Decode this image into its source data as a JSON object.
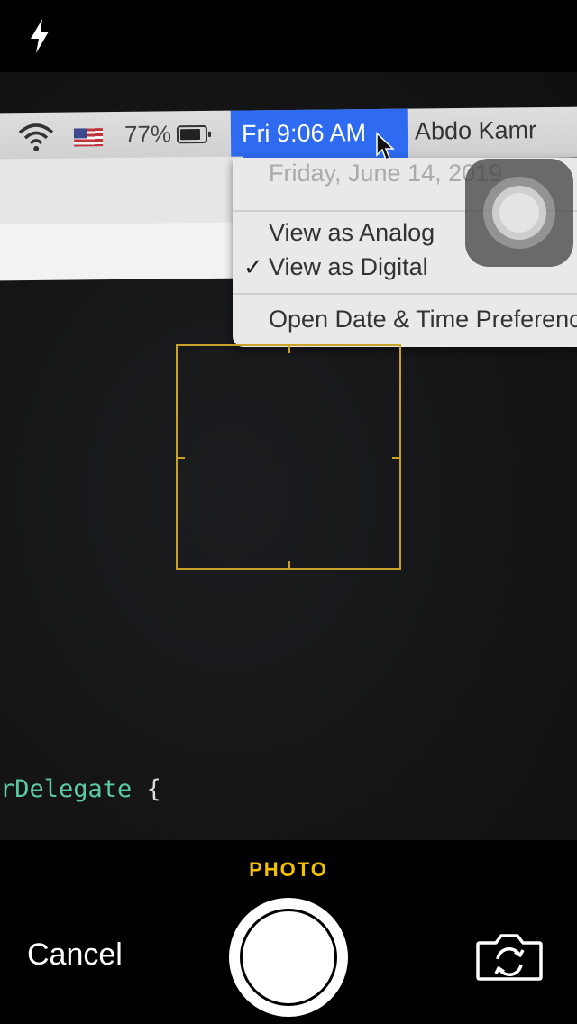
{
  "camera": {
    "top_bar": {
      "flash_icon": "lightning-bolt-icon"
    },
    "bottom_bar": {
      "mode_label": "PHOTO",
      "mode_color": "#f3c000",
      "cancel_label": "Cancel",
      "shutter_icon": "shutter-circle-icon",
      "flip_camera_icon": "camera-flip-icon"
    },
    "focus_box_color": "#c9a227"
  },
  "scene": {
    "menubar": {
      "battery_percent": "77%",
      "clock": "Fri 9:06 AM",
      "user": "Abdo Kamr",
      "clock_highlight": "#2e6bf0"
    },
    "clock_dropdown": {
      "date": "Friday, June 14, 2019",
      "items": [
        {
          "label": "View as Analog",
          "checked": false
        },
        {
          "label": "View as Digital",
          "checked": true
        },
        {
          "label": "Open Date & Time Preferences",
          "checked": false
        }
      ],
      "checkmark": "✓"
    },
    "code": {
      "token": "rDelegate",
      "brace": " {"
    }
  }
}
